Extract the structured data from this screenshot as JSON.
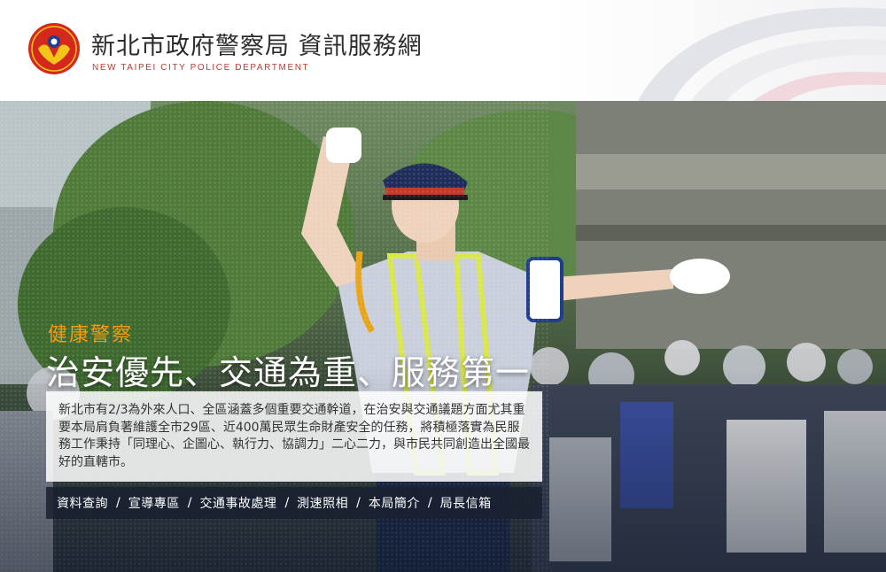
{
  "header": {
    "title": "新北市政府警察局 資訊服務網",
    "subtitle": "NEW TAIPEI CITY POLICE DEPARTMENT",
    "logo_icon": "police-emblem-icon"
  },
  "hero": {
    "tagline_small": "健康警察",
    "tagline_big": "治安優先、交通為重、服務第一",
    "blurb": "新北市有2/3為外來人口、全區涵蓋多個重要交通幹道，在治安與交通議題方面尤其重要本局肩負著維護全市29區、近400萬民眾生命財產安全的任務，將積極落實為民服務工作秉持「同理心、企圖心、執行力、協調力」二心二力，與市民共同創造出全國最好的直轄市。",
    "nav": [
      {
        "label": "資料查詢"
      },
      {
        "label": "宣導專區"
      },
      {
        "label": "交通事故處理"
      },
      {
        "label": "測速照相"
      },
      {
        "label": "本局簡介"
      },
      {
        "label": "局長信箱"
      }
    ],
    "separator": "/"
  },
  "colors": {
    "accent_orange": "#f39c12",
    "subtitle_red": "#c0392b",
    "logo_red": "#d4281c",
    "logo_gold": "#f5c518"
  }
}
